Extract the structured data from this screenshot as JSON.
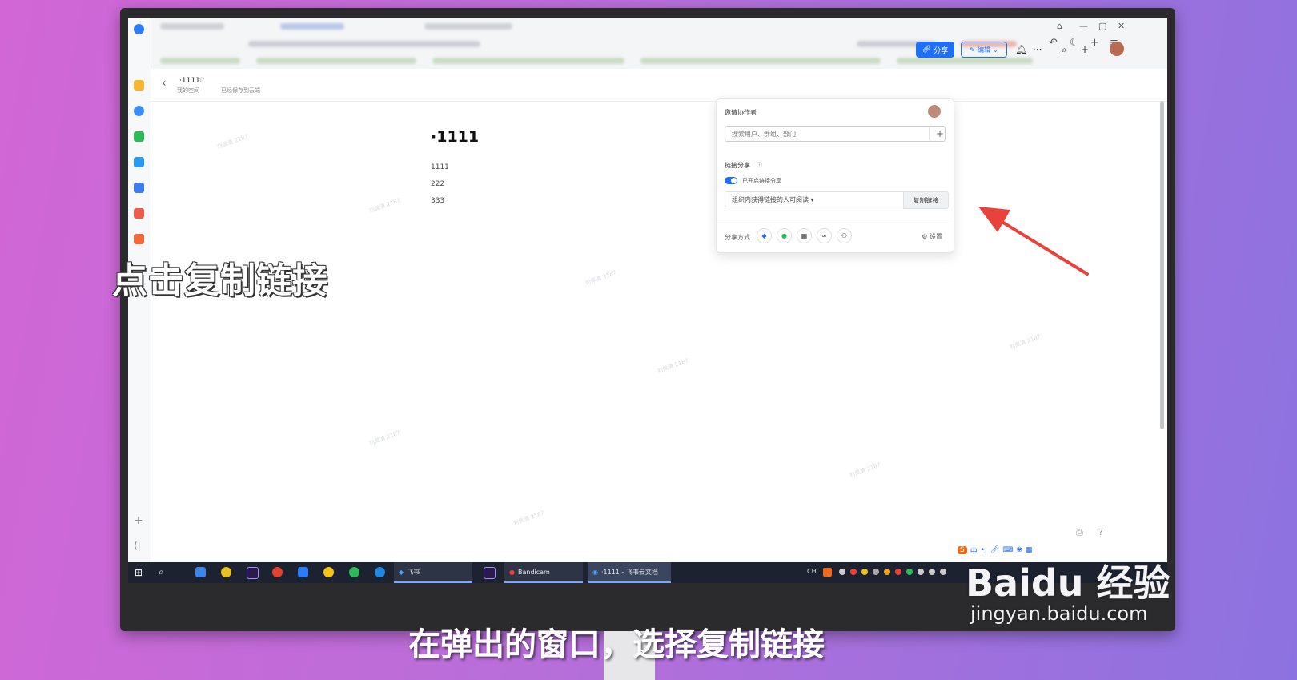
{
  "overlay": {
    "caption": "点击复制链接",
    "subtitle": "在弹出的窗口，选择复制链接",
    "watermark_logo": "Baidu 经验",
    "watermark_url": "jingyan.baidu.com"
  },
  "doc": {
    "title": "·1111",
    "path": "我的空间",
    "saved_status": "已经保存到云端",
    "heading": "·1111",
    "lines": [
      "1111",
      "222",
      "333"
    ],
    "watermark": "刘佩清 2187"
  },
  "header": {
    "share_label": "分享",
    "edit_label": "编辑"
  },
  "share_popover": {
    "invite_title": "邀请协作者",
    "search_placeholder": "搜索用户、群组、部门",
    "link_share_title": "链接分享",
    "toggle_label": "已开启链接分享",
    "permission_value": "组织内获得链接的人可阅读 ▾",
    "copy_link_label": "复制链接",
    "share_method_label": "分享方式",
    "settings_label": "设置"
  },
  "taskbar": {
    "items": [
      "飞书",
      "Bandicam",
      "·1111 - 飞书云文档"
    ],
    "tray_lang": "CH"
  },
  "ime": {
    "label": "中"
  },
  "colors": {
    "accent": "#1f6ff5",
    "arrow": "#e8423a",
    "taskbar": "#1c2230"
  }
}
